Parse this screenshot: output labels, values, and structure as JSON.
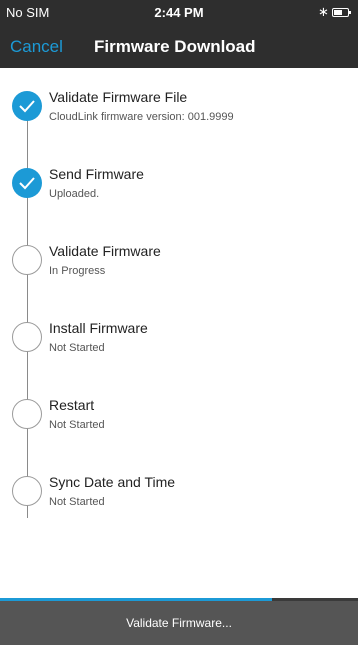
{
  "status_bar": {
    "carrier": "No SIM",
    "time": "2:44 PM",
    "bluetooth_icon": "bluetooth-icon",
    "battery_icon": "battery-icon"
  },
  "nav": {
    "cancel_label": "Cancel",
    "title": "Firmware Download"
  },
  "steps": [
    {
      "title": "Validate Firmware File",
      "status": "CloudLink firmware version: 001.9999",
      "state": "done"
    },
    {
      "title": "Send Firmware",
      "status": "Uploaded.",
      "state": "done"
    },
    {
      "title": "Validate Firmware",
      "status": "In Progress",
      "state": "pending"
    },
    {
      "title": "Install Firmware",
      "status": "Not Started",
      "state": "pending"
    },
    {
      "title": "Restart",
      "status": "Not Started",
      "state": "pending"
    },
    {
      "title": "Sync Date and Time",
      "status": "Not Started",
      "state": "pending"
    }
  ],
  "progress": {
    "fraction": 0.76,
    "label": "Validate Firmware..."
  },
  "colors": {
    "accent": "#1c9ad6",
    "nav_background": "#2e2e2e",
    "bottom_bar": "#555555"
  }
}
